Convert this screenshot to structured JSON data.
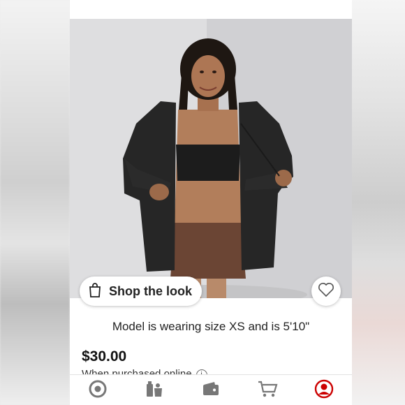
{
  "product": {
    "shop_the_look_label": "Shop the look",
    "model_caption": "Model is wearing size XS and is 5'10\"",
    "price": "$30.00",
    "price_note": "When purchased online"
  },
  "nav": {
    "items": [
      {
        "icon": "target-logo-icon"
      },
      {
        "icon": "grocery-icon"
      },
      {
        "icon": "wallet-icon"
      },
      {
        "icon": "cart-icon"
      },
      {
        "icon": "account-icon"
      }
    ]
  },
  "colors": {
    "accent": "#cc0000",
    "icon_gray": "#777777"
  }
}
